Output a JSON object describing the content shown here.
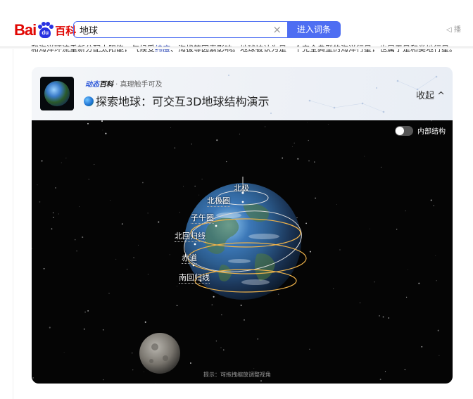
{
  "header": {
    "logo": {
      "bai": "Bai",
      "du": "du",
      "baike": "百科"
    },
    "search": {
      "value": "地球",
      "clear": "×"
    },
    "search_button": "进入词条",
    "speaker": "◁ 播"
  },
  "bg_text": {
    "before": "和海洋环流重新分配太阳能，气候受",
    "link": "纬度",
    "after": "、海拔等因素影响。地球被认为是一个完全典型的海洋行星，也属于是和类地行星。"
  },
  "card": {
    "badge": {
      "dong": "动态",
      "bk": "百科",
      "sep": " · ",
      "slogan": "真理触手可及"
    },
    "title": "探索地球：可交互3D地球结构演示",
    "collapse": "收起 ^",
    "toggle_label": "内部结构",
    "toggle_on": false,
    "labels": {
      "north_pole": "北极",
      "arctic_circle": "北极圈",
      "prime_meridian": "子午圈",
      "tropic_cancer": "北回归线",
      "equator": "赤道",
      "tropic_capricorn": "南回归线"
    },
    "hint": "提示：可拖拽缩放调整视角"
  },
  "colors": {
    "accent": "#4e6ef2",
    "baidu_red": "#e10602",
    "baidu_blue": "#2932e1",
    "orbit": "#f0b34a"
  }
}
